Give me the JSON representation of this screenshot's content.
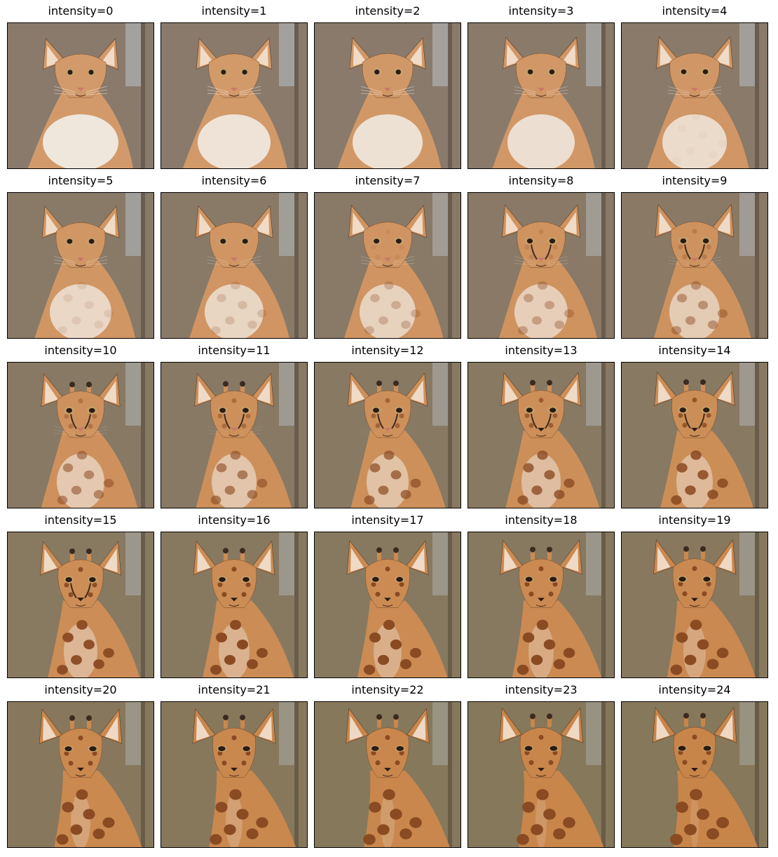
{
  "panels": [
    {
      "title": "intensity=0",
      "morph": 0.0
    },
    {
      "title": "intensity=1",
      "morph": 0.0417
    },
    {
      "title": "intensity=2",
      "morph": 0.0833
    },
    {
      "title": "intensity=3",
      "morph": 0.125
    },
    {
      "title": "intensity=4",
      "morph": 0.1667
    },
    {
      "title": "intensity=5",
      "morph": 0.2083
    },
    {
      "title": "intensity=6",
      "morph": 0.25
    },
    {
      "title": "intensity=7",
      "morph": 0.2917
    },
    {
      "title": "intensity=8",
      "morph": 0.3333
    },
    {
      "title": "intensity=9",
      "morph": 0.375
    },
    {
      "title": "intensity=10",
      "morph": 0.4167
    },
    {
      "title": "intensity=11",
      "morph": 0.4583
    },
    {
      "title": "intensity=12",
      "morph": 0.5
    },
    {
      "title": "intensity=13",
      "morph": 0.5417
    },
    {
      "title": "intensity=14",
      "morph": 0.5833
    },
    {
      "title": "intensity=15",
      "morph": 0.625
    },
    {
      "title": "intensity=16",
      "morph": 0.6667
    },
    {
      "title": "intensity=17",
      "morph": 0.7083
    },
    {
      "title": "intensity=18",
      "morph": 0.75
    },
    {
      "title": "intensity=19",
      "morph": 0.7917
    },
    {
      "title": "intensity=20",
      "morph": 0.8333
    },
    {
      "title": "intensity=21",
      "morph": 0.875
    },
    {
      "title": "intensity=22",
      "morph": 0.9167
    },
    {
      "title": "intensity=23",
      "morph": 0.9583
    },
    {
      "title": "intensity=24",
      "morph": 1.0
    }
  ],
  "colors": {
    "cat_background": "#8a7a6c",
    "giraffe_background": "#86785a",
    "fur": "#d29a6a",
    "giraffe_fur": "#c8854a",
    "spot": "#8a4a22",
    "chest": "#efe6dc",
    "eye": "#2a1c12",
    "nose": "#2b1a14"
  }
}
